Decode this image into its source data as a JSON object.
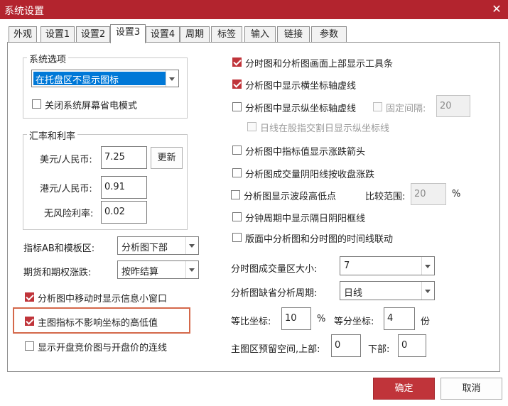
{
  "window": {
    "title": "系统设置",
    "close_glyph": "✕"
  },
  "tabs": [
    {
      "label": "外观"
    },
    {
      "label": "设置1"
    },
    {
      "label": "设置2"
    },
    {
      "label": "设置3"
    },
    {
      "label": "设置4"
    },
    {
      "label": "周期"
    },
    {
      "label": "标签"
    },
    {
      "label": "输入"
    },
    {
      "label": "链接"
    },
    {
      "label": "参数"
    }
  ],
  "active_tab": "设置3",
  "system_options": {
    "legend": "系统选项",
    "tray_select": "在托盘区不显示图标",
    "close_screensaver": {
      "label": "关闭系统屏幕省电模式",
      "checked": false
    }
  },
  "exchange": {
    "legend": "汇率和利率",
    "usd_label": "美元/人民币:",
    "usd_value": "7.25",
    "hkd_label": "港元/人民币:",
    "hkd_value": "0.91",
    "rate_label": "无风险利率:",
    "rate_value": "0.02",
    "update_button": "更新"
  },
  "indicator_ab": {
    "label": "指标AB和模板区:",
    "value": "分析图下部"
  },
  "futures": {
    "label": "期货和期权涨跌:",
    "value": "按昨结算"
  },
  "left_checks": [
    {
      "label": "分析图中移动时显示信息小窗口",
      "checked": true
    },
    {
      "label": "主图指标不影响坐标的高低值",
      "checked": true
    },
    {
      "label": "显示开盘竞价图与开盘价的连线",
      "checked": false
    }
  ],
  "right_checks": {
    "toolbar": {
      "label": "分时图和分析图画面上部显示工具条",
      "checked": true
    },
    "h_axis": {
      "label": "分析图中显示横坐标轴虚线",
      "checked": true
    },
    "v_axis": {
      "label": "分析图中显示纵坐标轴虚线",
      "checked": false
    },
    "fixed_interval": {
      "label": "固定间隔:",
      "checked": false,
      "value": "20"
    },
    "daily_split": {
      "label": "日线在股指交割日显示纵坐标线",
      "checked": false
    },
    "arrow": {
      "label": "分析图中指标值显示涨跌箭头",
      "checked": false
    },
    "volume": {
      "label": "分析图成交量阴阳线按收盘涨跌",
      "checked": false
    },
    "wave": {
      "label": "分析图显示波段高低点",
      "checked": false
    },
    "compare_label": "比较范围:",
    "compare_value": "20",
    "percent": "%",
    "minute_frame": {
      "label": "分钟周期中显示隔日阴阳框线",
      "checked": false
    },
    "timeline_link": {
      "label": "版面中分析图和分时图的时间线联动",
      "checked": false
    }
  },
  "volume_area": {
    "label": "分时图成交量区大小:",
    "value": "7"
  },
  "default_period": {
    "label": "分析图缺省分析周期:",
    "value": "日线"
  },
  "ratio_axis": {
    "label": "等比坐标:",
    "value": "10",
    "unit": "%"
  },
  "equal_axis": {
    "label": "等分坐标:",
    "value": "4",
    "unit": "份"
  },
  "reserve": {
    "top_label": "主图区预留空间,上部:",
    "top_value": "0",
    "bottom_label": "下部:",
    "bottom_value": "0"
  },
  "footer": {
    "ok": "确定",
    "cancel": "取消"
  },
  "colors": {
    "title_bar": "#b3242e",
    "accent": "#c0343a",
    "selection": "#0078d7",
    "highlight_box": "#d4684a"
  }
}
